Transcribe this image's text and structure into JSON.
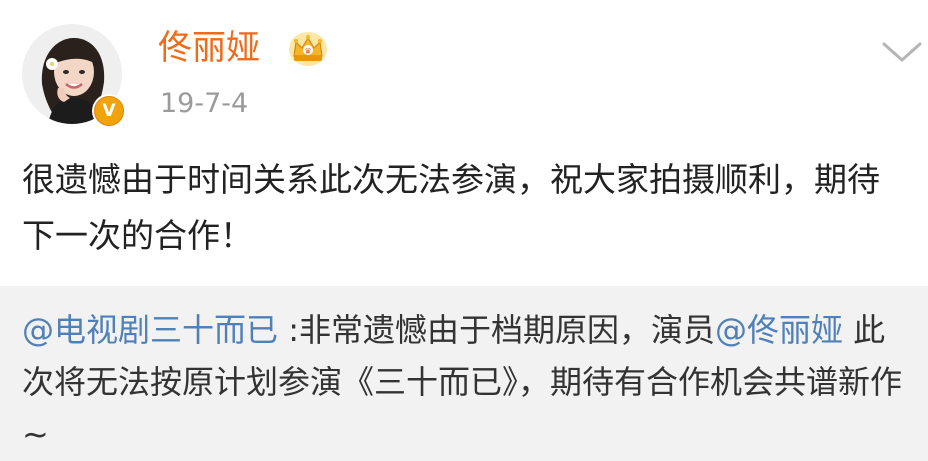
{
  "post": {
    "author": {
      "username": "佟丽娅",
      "avatar_icon": "avatar-photo",
      "verified_badge_icon": "verified-v-icon",
      "verified_badge_letter": "V",
      "vip_icon": "crown-icon"
    },
    "date": "19-7-4",
    "more_icon": "chevron-down-icon",
    "body": "很遗憾由于时间关系此次无法参演，祝大家拍摄顺利，期待下一次的合作！"
  },
  "repost": {
    "mention_source": "@电视剧三十而已",
    "text_part1": " :非常遗憾由于档期原因，演员",
    "mention_actor": "@佟丽娅",
    "text_part2": " 此次将无法按原计划参演《三十而已》，期待有合作机会共谱新作 ~"
  },
  "colors": {
    "username": "#f06a18",
    "mention": "#4f80b8",
    "date": "#9a9a9a",
    "body_text": "#222222",
    "repost_bg": "#f2f2f2",
    "badge": "#f2a20c"
  }
}
